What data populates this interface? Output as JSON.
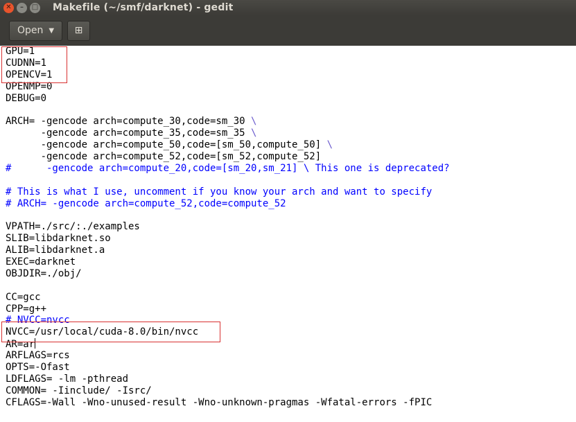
{
  "window": {
    "title": "Makefile (~/smf/darknet) - gedit",
    "close_glyph": "✕",
    "minimize_glyph": "–",
    "maximize_glyph": "□"
  },
  "toolbar": {
    "open_label": "Open",
    "open_caret": "▼",
    "new_icon": "⊞"
  },
  "editor": {
    "lines": [
      {
        "t": "GPU=1",
        "k": "plain"
      },
      {
        "t": "CUDNN=1",
        "k": "plain"
      },
      {
        "t": "OPENCV=1",
        "k": "plain"
      },
      {
        "t": "OPENMP=0",
        "k": "plain"
      },
      {
        "t": "DEBUG=0",
        "k": "plain"
      },
      {
        "t": "",
        "k": "plain"
      },
      {
        "t": "ARCH= -gencode arch=compute_30,code=sm_30 ",
        "k": "plain",
        "esc": "\\"
      },
      {
        "t": "      -gencode arch=compute_35,code=sm_35 ",
        "k": "plain",
        "esc": "\\"
      },
      {
        "t": "      -gencode arch=compute_50,code=[sm_50,compute_50] ",
        "k": "plain",
        "esc": "\\"
      },
      {
        "t": "      -gencode arch=compute_52,code=[sm_52,compute_52]",
        "k": "plain"
      },
      {
        "t": "#      -gencode arch=compute_20,code=[sm_20,sm_21] \\ This one is deprecated?",
        "k": "comment"
      },
      {
        "t": "",
        "k": "plain"
      },
      {
        "t": "# This is what I use, uncomment if you know your arch and want to specify",
        "k": "comment"
      },
      {
        "t": "# ARCH= -gencode arch=compute_52,code=compute_52",
        "k": "comment"
      },
      {
        "t": "",
        "k": "plain"
      },
      {
        "t": "VPATH=./src/:./examples",
        "k": "plain"
      },
      {
        "t": "SLIB=libdarknet.so",
        "k": "plain"
      },
      {
        "t": "ALIB=libdarknet.a",
        "k": "plain"
      },
      {
        "t": "EXEC=darknet",
        "k": "plain"
      },
      {
        "t": "OBJDIR=./obj/",
        "k": "plain"
      },
      {
        "t": "",
        "k": "plain"
      },
      {
        "t": "CC=gcc",
        "k": "plain"
      },
      {
        "t": "CPP=g++",
        "k": "plain"
      },
      {
        "t": "# NVCC=nvcc",
        "k": "comment"
      },
      {
        "t": "NVCC=/usr/local/cuda-8.0/bin/nvcc",
        "k": "plain"
      },
      {
        "t": "AR=ar",
        "k": "plain",
        "cursor": true
      },
      {
        "t": "ARFLAGS=rcs",
        "k": "plain"
      },
      {
        "t": "OPTS=-Ofast",
        "k": "plain"
      },
      {
        "t": "LDFLAGS= -lm -pthread",
        "k": "plain"
      },
      {
        "t": "COMMON= -Iinclude/ -Isrc/",
        "k": "plain"
      },
      {
        "t": "CFLAGS=-Wall -Wno-unused-result -Wno-unknown-pragmas -Wfatal-errors -fPIC",
        "k": "plain"
      }
    ]
  },
  "colors": {
    "comment": "#0000ff",
    "escape": "#6a5acd",
    "highlight_box": "#d83030"
  }
}
